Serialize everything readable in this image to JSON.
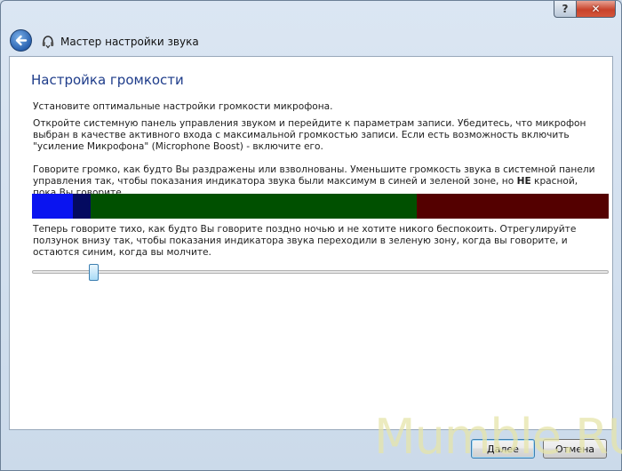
{
  "window": {
    "title": "Мастер настройки звука",
    "help_glyph": "?",
    "close_glyph": "✕"
  },
  "page": {
    "heading": "Настройка громкости",
    "paragraph1": "Установите оптимальные настройки громкости микрофона.",
    "paragraph2": "Откройте системную панель управления звуком и перейдите к параметрам записи. Убедитесь, что микрофон выбран в качестве активного входа с максимальной громкостью записи. Если есть возможность включить \"усиление Микрофона\" (Microphone Boost) - включите его.",
    "paragraph3_before": "Говорите громко, как будто Вы раздражены или взволнованы. Уменьшите громкость звука в системной панели управления так, чтобы показания индикатора звука были максимум в синей и зеленой зоне, но ",
    "paragraph3_bold": "НЕ",
    "paragraph3_after": " красной, пока Вы говорите.",
    "paragraph4": "Теперь говорите тихо, как будто Вы говорите поздно ночью и не хотите никого беспокоить. Отрегулируйте ползунок внизу так, чтобы показания индикатора звука переходили в зеленую зону, когда вы говорите, и остаются синим, когда вы молчите."
  },
  "meter": {
    "segments": [
      {
        "zone": "blue",
        "fraction": 0.071,
        "color": "#0a14f0"
      },
      {
        "zone": "dark-blue",
        "fraction": 0.031,
        "color": "#040a60"
      },
      {
        "zone": "green",
        "fraction": 0.565,
        "color": "#005000"
      },
      {
        "zone": "red",
        "fraction": 0.333,
        "color": "#540000"
      }
    ]
  },
  "slider": {
    "value": 0.107
  },
  "footer": {
    "next_label": "Далее",
    "cancel_label": "Отмена"
  },
  "watermark": {
    "text": "Mumble.RU"
  },
  "colors": {
    "heading": "#1e3c8a",
    "accent": "#3c7fb1"
  }
}
